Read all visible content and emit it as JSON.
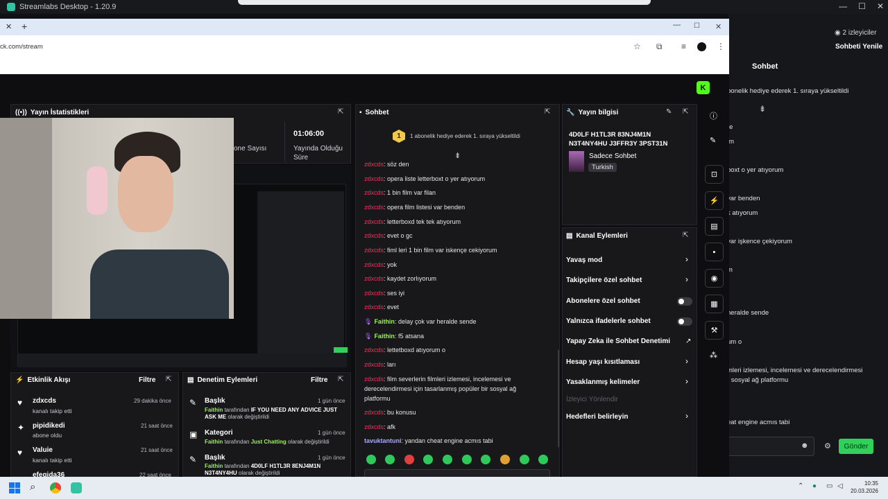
{
  "streamlabs": {
    "title": "Streamlabs Desktop - 1.20.9",
    "viewers": "2 izleyiciler",
    "refresh_chat": "Sohbeti Yenile",
    "chat_title": "Sohbet",
    "chat_lines": [
      "bonelik hediye ederek 1. sıraya yükseltildi",
      "re",
      "im",
      "boxt o yer atıyorum",
      "var benden",
      "k atıyorum",
      "var işkence çekiyorum",
      "m",
      "heralde sende",
      "um o",
      "mleri izlemesi, incelemesi ve derecelendirmesi",
      "r sosyal ağ platformu",
      "eat engine acmıs tabi"
    ],
    "send_label": "Gönder",
    "colors": {
      "accent": "#31d05a",
      "logo": "#31c3a2"
    }
  },
  "chrome": {
    "url": "ck.com/stream"
  },
  "stream_stats": {
    "title": "Yayın İstatistikleri",
    "stat1_value": "01:06:00",
    "stat1_label": "Yayında Olduğu Süre",
    "stat2_label": "one Sayısı"
  },
  "chat": {
    "title": "Sohbet",
    "pinned": "1 abonelik hediye ederek 1. sıraya yükseltildi",
    "messages": [
      {
        "user": "zdxcds",
        "text": ": söz den",
        "type": "u1"
      },
      {
        "user": "zdxcds",
        "text": ": opera liste letterboxt o yer atıyorum",
        "type": "u1"
      },
      {
        "user": "zdxcds",
        "text": ": 1 bin film var filan",
        "type": "u1"
      },
      {
        "user": "zdxcds",
        "text": ": opera film listesi var benden",
        "type": "u1"
      },
      {
        "user": "zdxcds",
        "text": ": letterboxd tek tek atıyorum",
        "type": "u1"
      },
      {
        "user": "zdxcds",
        "text": ": evet o gc",
        "type": "u1"
      },
      {
        "user": "zdxcds",
        "text": ": fiml leri 1 bin film var iskençe cekiyorum",
        "type": "u1"
      },
      {
        "user": "zdxcds",
        "text": ": yok",
        "type": "u1"
      },
      {
        "user": "zdxcds",
        "text": ": kaydet zorlıyorum",
        "type": "u1"
      },
      {
        "user": "zdxcds",
        "text": ": ses iyi",
        "type": "u1"
      },
      {
        "user": "zdxcds",
        "text": ": evet",
        "type": "u1"
      },
      {
        "user": "Faithin",
        "text": ": delay çok var heralde sende",
        "type": "u2"
      },
      {
        "user": "Faithin",
        "text": ": f5 atsana",
        "type": "u2"
      },
      {
        "user": "zdxcds",
        "text": ": lettetboxd atıyorum o",
        "type": "u1"
      },
      {
        "user": "zdxcds",
        "text": ": ları",
        "type": "u1"
      },
      {
        "user": "zdxcds",
        "text": ": film severlerin filmleri izlemesi, incelemesi ve",
        "type": "u1"
      },
      {
        "user": "",
        "text": "derecelendirmesi için tasarlanmış popüler bir sosyal ağ",
        "type": "cont"
      },
      {
        "user": "",
        "text": "platformu",
        "type": "cont"
      },
      {
        "user": "zdxcds",
        "text": ": bu konusu",
        "type": "u1"
      },
      {
        "user": "zdxcds",
        "text": ": afk",
        "type": "u1"
      },
      {
        "user": "tavuktantuni",
        "text": ": yandan cheat engine acmıs tabi",
        "type": "u3"
      }
    ]
  },
  "stream_info": {
    "title": "Yayın bilgisi",
    "stream_title_l1": "4D0LF H1TL3R 83NJ4M1N",
    "stream_title_l2": "N3T4NY4HU J3FFR3Y 3PST31N",
    "category": "Sadece Sohbet",
    "tag": "Turkish"
  },
  "channel_actions": {
    "title": "Kanal Eylemleri",
    "items": [
      "Yavaş mod",
      "Takipçilere özel sohbet",
      "Abonelere özel sohbet",
      "Yalnızca ifadelerle sohbet",
      "Yapay Zeka ile Sohbet Denetimi",
      "Hesap yaşı kısıtlaması",
      "Yasaklanmış kelimeler",
      "İzleyici Yönlendir",
      "Hedefleri belirleyin"
    ]
  },
  "activity": {
    "title": "Etkinlik Akışı",
    "filter": "Filtre",
    "items": [
      {
        "user": "zdxcds",
        "desc": "kanalı takip etti",
        "time": "29 dakika önce"
      },
      {
        "user": "pipidikedi",
        "desc": "abone oldu",
        "time": "21 saat önce"
      },
      {
        "user": "Valuie",
        "desc": "kanalı takip etti",
        "time": "21 saat önce"
      },
      {
        "user": "efegida36",
        "desc": "",
        "time": "22 saat önce"
      }
    ]
  },
  "moderation": {
    "title": "Denetim Eylemleri",
    "filter": "Filtre",
    "items": [
      {
        "title": "Başlık",
        "by": "Faithin",
        "mid": " tarafından ",
        "value": "IF YOU NEED ANY ADVICE JUST ASK ME",
        "tail": " olarak değiştirildi",
        "time": "1 gün önce"
      },
      {
        "title": "Kategori",
        "by": "Faithin",
        "mid": " tarafından ",
        "value": "Just Chatting",
        "tail": " olarak değiştirildi",
        "time": "1 gün önce"
      },
      {
        "title": "Başlık",
        "by": "Faithin",
        "mid": " tarafından ",
        "value": "4D0LF H1TL3R 8ENJ4M1N N3T4NY4HU",
        "tail": " olarak değiştirildi",
        "time": "1 gün önce"
      }
    ]
  },
  "taskbar": {
    "time": "10:35",
    "date": "20.03.2026"
  }
}
